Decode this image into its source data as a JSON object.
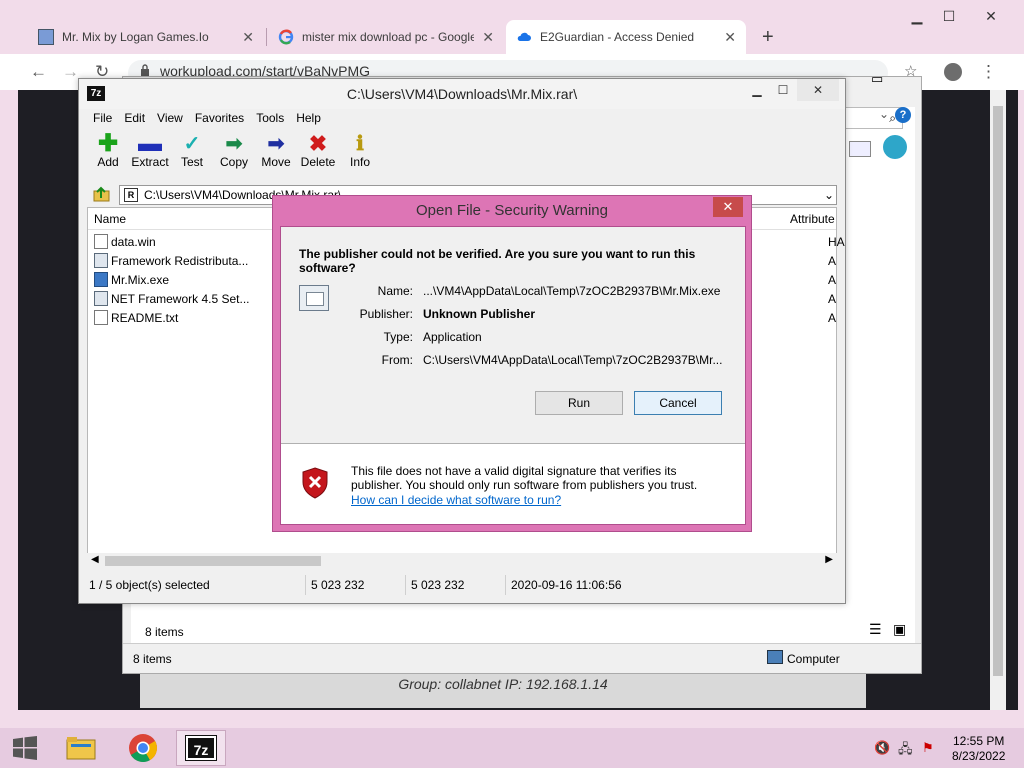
{
  "browser": {
    "tabs": [
      {
        "title": "Mr. Mix by Logan Games.Io",
        "active": false
      },
      {
        "title": "mister mix download pc - Google",
        "active": false
      },
      {
        "title": "E2Guardian - Access Denied",
        "active": true
      }
    ],
    "new_tab": "+",
    "url": "workupload.com/start/vBaNvPMG",
    "group_text": "Group: collabnet   IP: 192.168.1.14"
  },
  "explorer": {
    "status_left": "8 items",
    "items_count": "8 items",
    "location": "Computer"
  },
  "sevenzip": {
    "title": "C:\\Users\\VM4\\Downloads\\Mr.Mix.rar\\",
    "menu": [
      "File",
      "Edit",
      "View",
      "Favorites",
      "Tools",
      "Help"
    ],
    "tools": [
      {
        "label": "Add",
        "icon": "plus-icon",
        "color": "#1aa31a"
      },
      {
        "label": "Extract",
        "icon": "minus-icon",
        "color": "#1f2fb8"
      },
      {
        "label": "Test",
        "icon": "check-icon",
        "color": "#1bb0b0"
      },
      {
        "label": "Copy",
        "icon": "copy-arrow-icon",
        "color": "#1a8a4a"
      },
      {
        "label": "Move",
        "icon": "move-arrow-icon",
        "color": "#1f2fa0"
      },
      {
        "label": "Delete",
        "icon": "delete-x-icon",
        "color": "#d01c1c"
      },
      {
        "label": "Info",
        "icon": "info-icon",
        "color": "#b89a10"
      }
    ],
    "address": "C:\\Users\\VM4\\Downloads\\Mr.Mix.rar\\",
    "columns": {
      "name": "Name",
      "attributes": "Attribute"
    },
    "files": [
      {
        "name": "data.win",
        "type": "file",
        "attr": "HA"
      },
      {
        "name": "Framework Redistributa...",
        "type": "setup",
        "attr": "A"
      },
      {
        "name": "Mr.Mix.exe",
        "type": "exe",
        "attr": "A"
      },
      {
        "name": "NET Framework 4.5 Set...",
        "type": "setup",
        "attr": "A"
      },
      {
        "name": "README.txt",
        "type": "file",
        "attr": "A"
      }
    ],
    "status": {
      "selected": "1 / 5 object(s) selected",
      "size": "5 023 232",
      "packed": "5 023 232",
      "modified": "2020-09-16 11:06:56"
    }
  },
  "dialog": {
    "title": "Open File - Security Warning",
    "close": "✕",
    "question": "The publisher could not be verified.  Are you sure you want to run this software?",
    "fields": [
      {
        "label": "Name:",
        "value": "...\\VM4\\AppData\\Local\\Temp\\7zOC2B2937B\\Mr.Mix.exe",
        "bold": false
      },
      {
        "label": "Publisher:",
        "value": "Unknown Publisher",
        "bold": true
      },
      {
        "label": "Type:",
        "value": "Application",
        "bold": false
      },
      {
        "label": "From:",
        "value": "C:\\Users\\VM4\\AppData\\Local\\Temp\\7zOC2B2937B\\Mr...",
        "bold": false
      }
    ],
    "run_label": "Run",
    "cancel_label": "Cancel",
    "warning": "This file does not have a valid digital signature that verifies its publisher.  You should only run software from publishers you trust.",
    "link": "How can I decide what software to run?"
  },
  "taskbar": {
    "time": "12:55 PM",
    "date": "8/23/2022"
  },
  "colors": {
    "dialog_frame": "#dd75b5",
    "close_button": "#c74b4b",
    "link": "#0066cc"
  }
}
